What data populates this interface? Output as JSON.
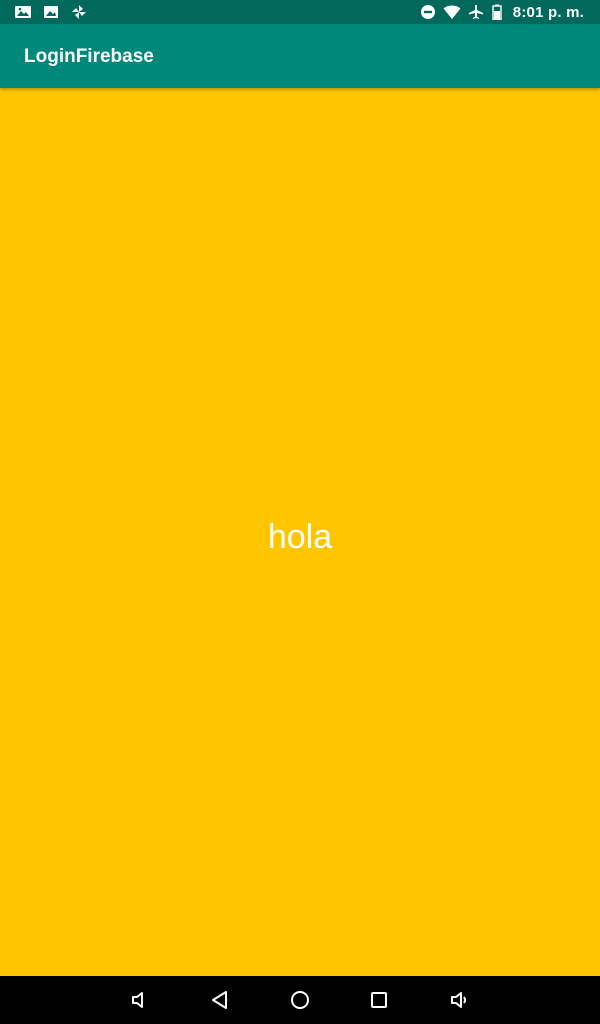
{
  "status_bar": {
    "time": "8:01 p. m.",
    "left_icons": [
      "photo-notification-icon",
      "gallery-notification-icon",
      "pinwheel-notification-icon"
    ],
    "right_icons": [
      "do-not-disturb-icon",
      "wifi-icon",
      "airplane-mode-icon",
      "battery-icon"
    ],
    "background": "#00695c"
  },
  "app_bar": {
    "title": "LoginFirebase",
    "background": "#00897b"
  },
  "main": {
    "text": "hola",
    "background": "#ffc600",
    "text_color": "#ffffff"
  },
  "nav_bar": {
    "buttons": [
      "volume-down-icon",
      "back-icon",
      "home-icon",
      "recents-icon",
      "volume-up-icon"
    ]
  }
}
